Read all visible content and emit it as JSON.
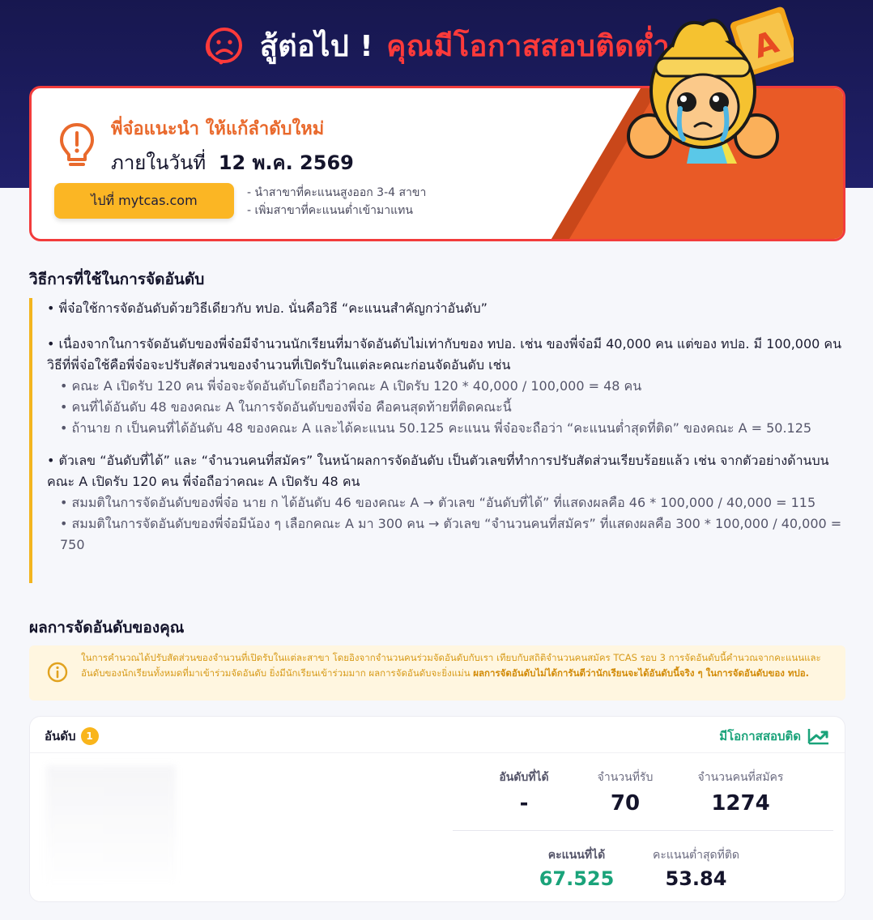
{
  "hero": {
    "title_white": "สู้ต่อไป !",
    "title_red": "คุณมีโอกาสสอบติดต่ำ"
  },
  "advice": {
    "heading": "พี่จ๋อแนะนำ ให้แก้ลำดับใหม่",
    "date_prefix": "ภายในวันที่",
    "date_value": "12 พ.ค. 2569",
    "button_label": "ไปที่ mytcas.com",
    "tips": [
      "- นำสาขาที่คะแนนสูงออก 3-4 สาขา",
      "- เพิ่มสาขาที่คะแนนต่ำเข้ามาแทน"
    ]
  },
  "method": {
    "title": "วิธีการที่ใช้ในการจัดอันดับ",
    "b1": "• พี่จ๋อใช้การจัดอันดับด้วยวิธีเดียวกับ ทปอ. นั่นคือวิธี “คะแนนสำคัญกว่าอันดับ”",
    "b2": "• เนื่องจากในการจัดอันดับของพี่จ๋อมีจำนวนนักเรียนที่มาจัดอันดับไม่เท่ากับของ ทปอ. เช่น ของพี่จ๋อมี 40,000 คน แต่ของ ทปอ. มี 100,000 คน วิธีที่พี่จ๋อใช้คือพี่จ๋อจะปรับสัดส่วนของจำนวนที่เปิดรับในแต่ละคณะก่อนจัดอันดับ เช่น",
    "b2_sub1": "• คณะ A เปิดรับ 120 คน พี่จ๋อจะจัดอันดับโดยถือว่าคณะ A เปิดรับ 120 * 40,000 / 100,000 = 48 คน",
    "b2_sub2": "• คนที่ได้อันดับ 48 ของคณะ A ในการจัดอันดับของพี่จ๋อ คือคนสุดท้ายที่ติดคณะนี้",
    "b2_sub3": "• ถ้านาย ก เป็นคนที่ได้อันดับ 48 ของคณะ A และได้คะแนน 50.125 คะแนน พี่จ๋อจะถือว่า “คะแนนต่ำสุดที่ติด” ของคณะ A = 50.125",
    "b3": "• ตัวเลข “อันดับที่ได้” และ “จำนวนคนที่สมัคร” ในหน้าผลการจัดอันดับ เป็นตัวเลขที่ทำการปรับสัดส่วนเรียบร้อยแล้ว เช่น จากตัวอย่างด้านบน คณะ A เปิดรับ 120 คน พี่จ๋อถือว่าคณะ A เปิดรับ 48 คน",
    "b3_sub1": "• สมมติในการจัดอันดับของพี่จ๋อ นาย ก ได้อันดับ 46 ของคณะ A → ตัวเลข “อันดับที่ได้” ที่แสดงผลคือ 46 * 100,000 / 40,000 = 115",
    "b3_sub2": "• สมมติในการจัดอันดับของพี่จ๋อมีน้อง ๆ เลือกคณะ A มา 300 คน → ตัวเลข “จำนวนคนที่สมัคร” ที่แสดงผลคือ 300 * 100,000 / 40,000 = 750"
  },
  "results": {
    "title": "ผลการจัดอันดับของคุณ",
    "notice": "ในการคำนวณได้ปรับสัดส่วนของจำนวนที่เปิดรับในแต่ละสาขา โดยอิงจากจำนวนคนร่วมจัดอันดับกับเรา เทียบกับสถิติจำนวนคนสมัคร TCAS รอบ 3 การจัดอันดับนี้คำนวณจากคะแนนและอันดับของนักเรียนทั้งหมดที่มาเข้าร่วมจัดอันดับ ยิ่งมีนักเรียนเข้าร่วมมาก ผลการจัดอันดับจะยิ่งแม่น",
    "notice_bold": "ผลการจัดอันดับไม่ได้การันตีว่านักเรียนจะได้อันดับนี้จริง ๆ ในการจัดอันดับของ ทปอ.",
    "rank_label": "อันดับ",
    "rank_number": "1",
    "status": "มีโอกาสสอบติด",
    "labels": {
      "rank_obtained": "อันดับที่ได้",
      "seats": "จำนวนที่รับ",
      "applicants": "จำนวนคนที่สมัคร",
      "score": "คะแนนที่ได้",
      "min_score": "คะแนนต่ำสุดที่ติด"
    },
    "values": {
      "rank_obtained": "-",
      "seats": "70",
      "applicants": "1274",
      "score": "67.525",
      "min_score": "53.84"
    }
  },
  "colors": {
    "hero_bg": "#1b1b5c",
    "accent_red": "#ff3a3a",
    "accent_orange": "#e9692c",
    "button_yellow": "#fbb624",
    "green": "#1aa37a"
  },
  "icons": [
    "sad-face-icon",
    "lightbulb-icon",
    "info-icon",
    "trending-up-icon"
  ]
}
